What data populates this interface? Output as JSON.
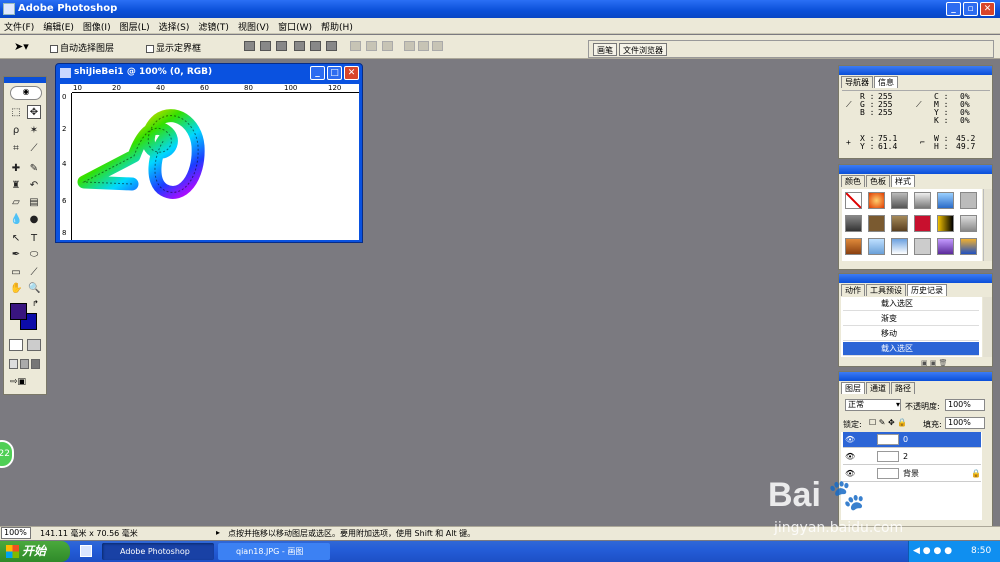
{
  "app": {
    "title": "Adobe Photoshop"
  },
  "menu": [
    "文件(F)",
    "编辑(E)",
    "图像(I)",
    "图层(L)",
    "选择(S)",
    "滤镜(T)",
    "视图(V)",
    "窗口(W)",
    "帮助(H)"
  ],
  "options": {
    "auto_select_label": "自动选择图层",
    "show_bounds_label": "显示定界框"
  },
  "wells": {
    "brushes": "画笔",
    "file_browser": "文件浏览器"
  },
  "document": {
    "title": "shiJieBei1 @ 100% (0, RGB)",
    "ruler_h": [
      "10",
      "20",
      "40",
      "60",
      "80",
      "100",
      "120"
    ],
    "ruler_v": [
      "0",
      "2",
      "4",
      "6",
      "8"
    ]
  },
  "navigator": {
    "tabs": [
      "导航器",
      "信息"
    ],
    "r_label": "R :",
    "g_label": "G :",
    "b_label": "B :",
    "r": "255",
    "g": "255",
    "b": "255",
    "c_label": "C :",
    "m_label": "M :",
    "y_label": "Y :",
    "k_label": "K :",
    "c": "0%",
    "m": "0%",
    "y": "0%",
    "k": "0%",
    "x_label": "X :",
    "y2_label": "Y :",
    "x": "75.1",
    "ypos": "61.4",
    "w_label": "W :",
    "h_label": "H :",
    "w": "45.2",
    "h": "49.7"
  },
  "swatches": {
    "tabs": [
      "颜色",
      "色板",
      "样式"
    ]
  },
  "history": {
    "tabs": [
      "动作",
      "工具预设",
      "历史记录"
    ],
    "items": [
      "载入选区",
      "渐变",
      "移动",
      "载入选区"
    ]
  },
  "layers": {
    "tabs": [
      "图层",
      "通道",
      "路径"
    ],
    "blend_mode": "正常",
    "opacity_label": "不透明度:",
    "opacity": "100%",
    "lock_label": "锁定:",
    "fill_label": "填充:",
    "fill": "100%",
    "items": [
      "0",
      "2",
      "背景"
    ]
  },
  "status": {
    "zoom": "100%",
    "doc_size": "141.11 毫米 x 70.56 毫米",
    "hint": "点按并拖移以移动图层或选区。要用附加选项，使用 Shift 和 Alt 键。"
  },
  "badge": "22",
  "taskbar": {
    "start": "开始",
    "tasks": [
      "Adobe Photoshop",
      "qian18.JPG - 画图"
    ],
    "time": "8:50"
  },
  "watermark": {
    "brand": "Bai",
    "brand2": "经验",
    "url": "jingyan.baidu.com"
  },
  "colors": {
    "foreground": "#39157f",
    "background": "#0c0ca8",
    "titlebar": "#0a4fd8",
    "workspace": "#7b7a80"
  }
}
